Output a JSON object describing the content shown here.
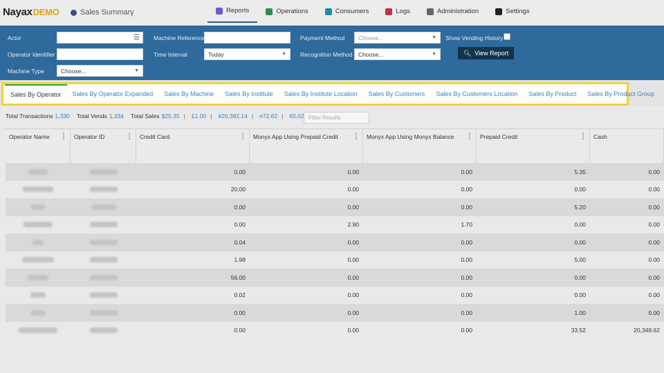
{
  "header": {
    "logo_main": "Nayax",
    "logo_demo": "DEMO",
    "page_title": "Sales Summary",
    "nav": [
      {
        "label": "Reports",
        "icon": "reports-icon",
        "color": "#6a5acd"
      },
      {
        "label": "Operations",
        "icon": "operations-icon",
        "color": "#2e8b57"
      },
      {
        "label": "Consumers",
        "icon": "consumers-icon",
        "color": "#1e90a0"
      },
      {
        "label": "Logs",
        "icon": "logs-icon",
        "color": "#c0304a"
      },
      {
        "label": "Administration",
        "icon": "administration-icon",
        "color": "#666666"
      },
      {
        "label": "Settings",
        "icon": "settings-icon",
        "color": "#222222"
      }
    ]
  },
  "filters": {
    "actor_label": "Actor",
    "operator_identifier_label": "Operator Identifier",
    "machine_type_label": "Machine Type",
    "machine_type_value": "Choose...",
    "machine_reference_label": "Machine Reference",
    "time_interval_label": "Time Interval",
    "time_interval_value": "Today",
    "payment_method_label": "Payment Method",
    "payment_method_value": "Choose...",
    "recognition_method_label": "Recognition Method",
    "recognition_method_value": "Choose...",
    "show_vending_history_label": "Show Vending History",
    "view_report_label": "View Report"
  },
  "tabs": [
    "Sales By Operator",
    "Sales By Operator Expanded",
    "Sales By Machine",
    "Sales By Institute",
    "Sales By Institute Location",
    "Sales By Customers",
    "Sales By Customers Location",
    "Sales By Product",
    "Sales By Product Group"
  ],
  "totals": {
    "transactions_label": "Total Transactions",
    "transactions_value": "1,330",
    "vends_label": "Total Vends",
    "vends_value": "1,334",
    "sales_label": "Total Sales",
    "sales_values": [
      "$25.35",
      "£1.00",
      "¥20,382.14",
      "¤72.82",
      "€0.02"
    ],
    "filter_placeholder": "Filter Results"
  },
  "table": {
    "columns": [
      "Operator Name",
      "Operator ID",
      "Credit Card",
      "Monyx App Using Prepaid Credit",
      "Monyx App Using Monyx Balance",
      "Prepaid Credit",
      "Cash"
    ],
    "rows": [
      [
        "0.00",
        "0.00",
        "0.00",
        "5.35",
        "0.00"
      ],
      [
        "20.00",
        "0.00",
        "0.00",
        "0.00",
        "0.00"
      ],
      [
        "0.00",
        "0.00",
        "0.00",
        "5.20",
        "0.00"
      ],
      [
        "0.00",
        "2.90",
        "1.70",
        "0.00",
        "0.00"
      ],
      [
        "0.04",
        "0.00",
        "0.00",
        "0.00",
        "0.00"
      ],
      [
        "1.98",
        "0.00",
        "0.00",
        "5.00",
        "0.00"
      ],
      [
        "56.00",
        "0.00",
        "0.00",
        "0.00",
        "0.00"
      ],
      [
        "0.02",
        "0.00",
        "0.00",
        "0.00",
        "0.00"
      ],
      [
        "0.00",
        "0.00",
        "0.00",
        "1.00",
        "0.00"
      ],
      [
        "0.00",
        "0.00",
        "0.00",
        "33.52",
        "20,348.62"
      ]
    ]
  },
  "colors": {
    "filter_bar": "#2e6a9c",
    "tab_link": "#3f7dbf",
    "tab_highlight": "#f2d03b",
    "active_tab_accent": "#29a745",
    "view_button": "#12344f"
  }
}
